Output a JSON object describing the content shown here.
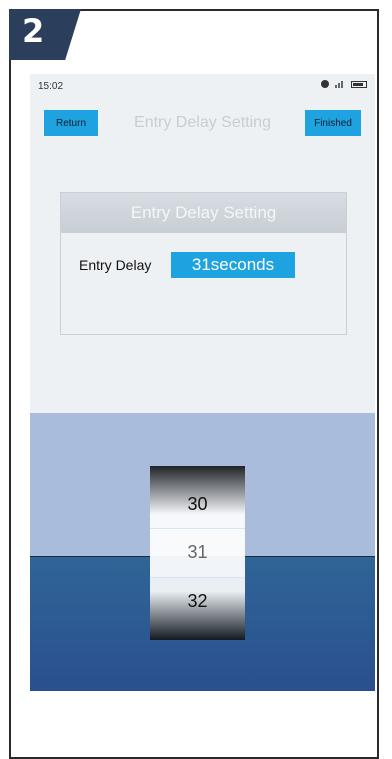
{
  "step": {
    "number": "2"
  },
  "status_bar": {
    "time": "15:02"
  },
  "header": {
    "return_label": "Return",
    "title": "Entry Delay Setting",
    "finished_label": "Finished"
  },
  "dialog": {
    "title": "Entry Delay Setting",
    "label": "Entry Delay",
    "value": "31seconds"
  },
  "picker": {
    "items": [
      "30",
      "31",
      "32"
    ],
    "selected": "31"
  },
  "colors": {
    "accent": "#1fa3e0",
    "picker_top": "#a9bcdc",
    "picker_bottom": "#2a4f8e"
  }
}
